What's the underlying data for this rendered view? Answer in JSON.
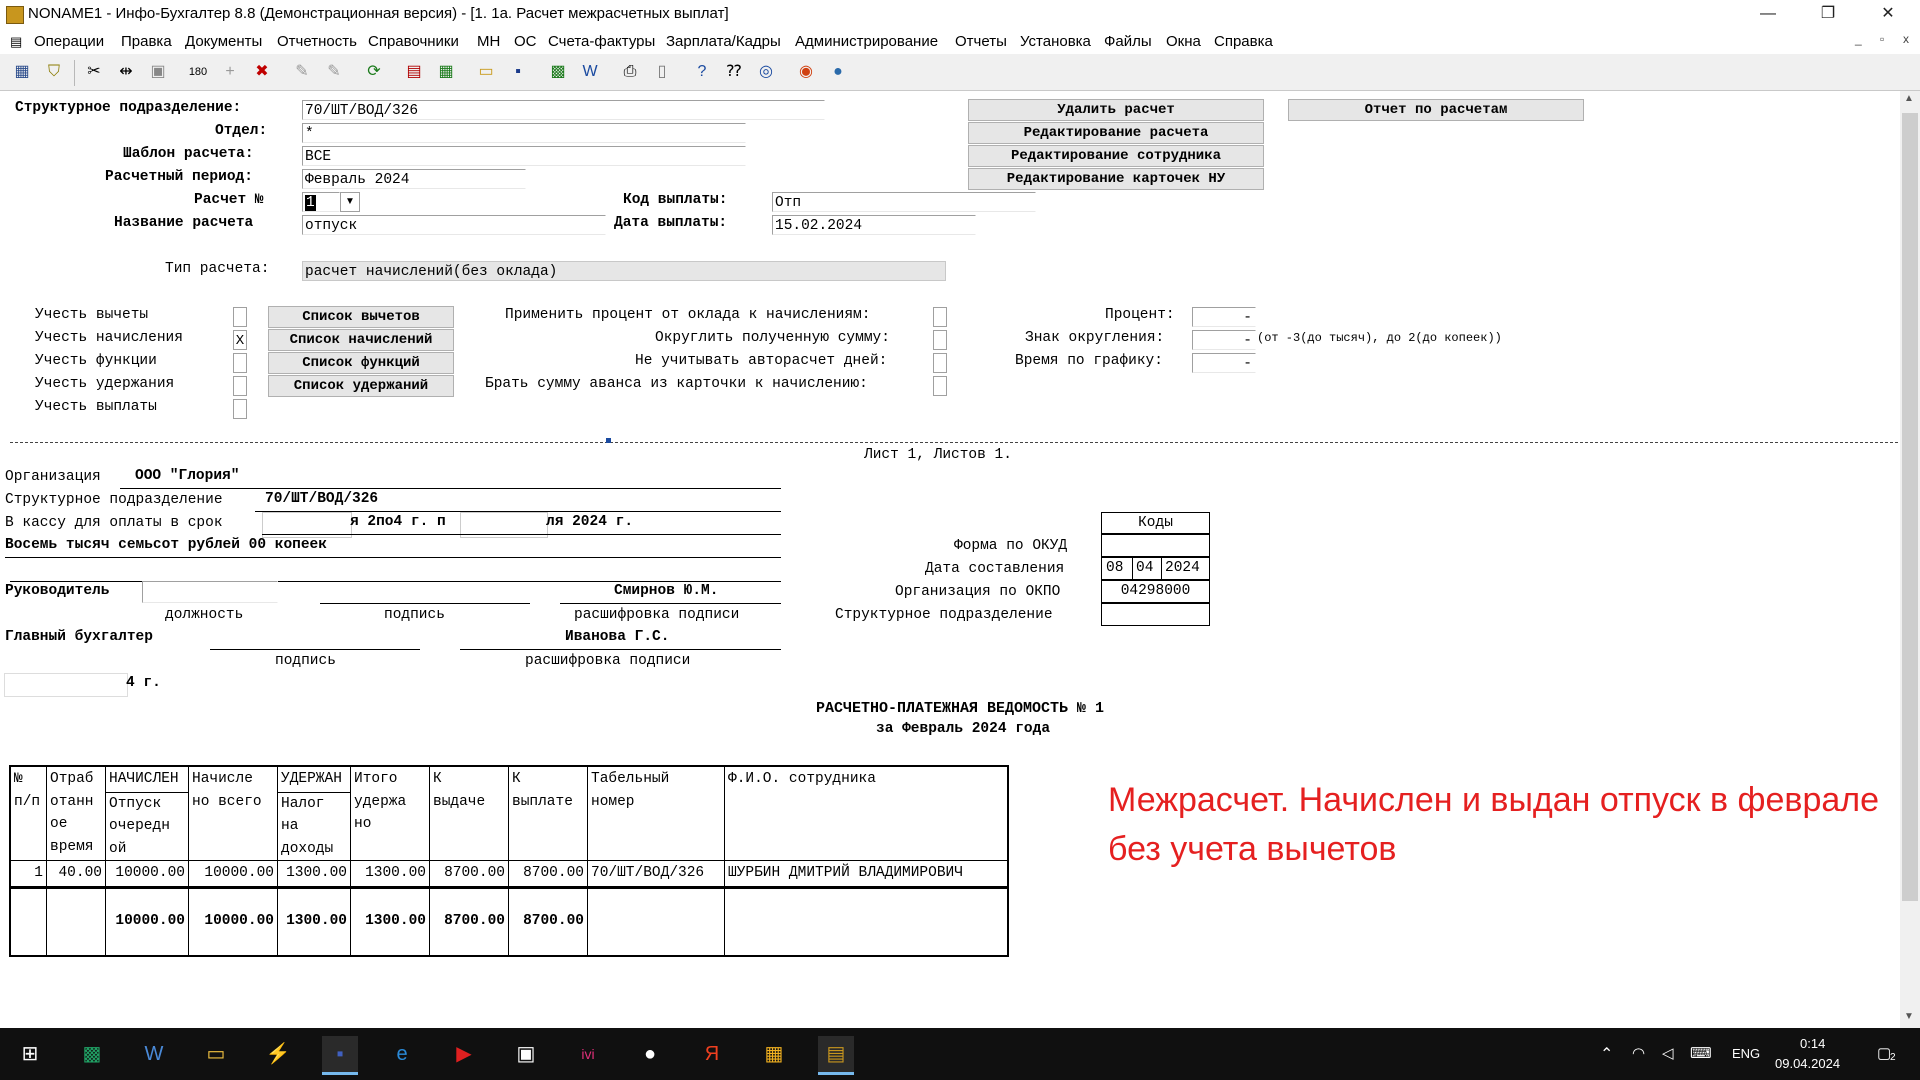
{
  "window": {
    "title": "NONAME1 - Инфо-Бухгалтер 8.8 (Демонстрационная версия) - [1. 1а. Расчет межрасчетных выплат]",
    "minimize": "—",
    "maximize": "❐",
    "close": "✕"
  },
  "menu": {
    "items": [
      "Операции",
      "Правка",
      "Документы",
      "Отчетность",
      "Справочники",
      "МН",
      "ОС",
      "Счета-фактуры",
      "Зарплата/Кадры",
      "Администрирование",
      "Отчеты",
      "Установка",
      "Файлы",
      "Окна",
      "Справка"
    ],
    "mdi_min": "_",
    "mdi_restore": "▫",
    "mdi_close": "x"
  },
  "form": {
    "structural_unit_label": "Структурное подразделение:",
    "structural_unit_value": "70/ШТ/ВОД/326",
    "department_label": "Отдел:",
    "department_value": "*",
    "template_label": "Шаблон расчета:",
    "template_value": "ВСЕ",
    "period_label": "Расчетный период:",
    "period_value": "Февраль 2024",
    "calc_no_label": "Расчет №",
    "calc_no_value": "1",
    "calc_name_label": "Название расчета",
    "calc_name_value": "отпуск",
    "pay_code_label": "Код выплаты:",
    "pay_code_value": "Отп",
    "pay_date_label": "Дата выплаты:",
    "pay_date_value": "15.02.2024",
    "calc_type_label": "Тип расчета:",
    "calc_type_value": "расчет начислений(без оклада)",
    "btn_delete": "Удалить расчет",
    "btn_edit_calc": "Редактирование расчета",
    "btn_edit_employee": "Редактирование сотрудника",
    "btn_edit_cards": "Редактирование карточек НУ",
    "btn_report": "Отчет по расчетам",
    "consider": [
      {
        "label": "Учесть вычеты",
        "checked": ""
      },
      {
        "label": "Учесть начисления",
        "checked": "X"
      },
      {
        "label": "Учесть функции",
        "checked": ""
      },
      {
        "label": "Учесть удержания",
        "checked": ""
      },
      {
        "label": "Учесть выплаты",
        "checked": ""
      }
    ],
    "list_buttons": [
      "Список вычетов",
      "Список начислений",
      "Список функций",
      "Список удержаний"
    ],
    "options": [
      {
        "label": "Применить процент от оклада к начислениям:",
        "checked": ""
      },
      {
        "label": "Округлить полученную сумму:",
        "checked": ""
      },
      {
        "label": "Не учитывать авторасчет дней:",
        "checked": ""
      },
      {
        "label": "Брать сумму аванса из карточки к начислению:",
        "checked": ""
      }
    ],
    "percent_label": "Процент:",
    "percent_value": "-",
    "round_sign_label": "Знак округления:",
    "round_sign_value": "-",
    "round_hint": "(от -3(до тысяч), до 2(до копеек))",
    "schedule_label": "Время по графику:",
    "schedule_value": "-"
  },
  "report": {
    "sheet": "Лист 1, Листов 1.",
    "org_label": "Организация",
    "org_value": "ООО \"Глория\"",
    "unit_label": "Структурное подразделение",
    "unit_value": "70/ШТ/ВОД/326",
    "cash_label": "В кассу для оплаты в срок",
    "cash_mid": "я 2по4 г. п",
    "cash_end": "ля 2024 г.",
    "amount_words": "Восемь тысяч семьсот рублей 00 копеек",
    "head_label": "Руководитель",
    "head_name": "Смирнов Ю.М.",
    "position_caption": "должность",
    "signature_caption": "подпись",
    "decode_caption": "расшифровка подписи",
    "chief_label": "Главный бухгалтер",
    "chief_name": "Иванова Г.С.",
    "date_tail": "4 г.",
    "codes_header": "Коды",
    "okud_label": "Форма по ОКУД",
    "date_label": "Дата составления",
    "date_day": "08",
    "date_month": "04",
    "date_year": "2024",
    "okpo_label": "Организация по ОКПО",
    "okpo_value": "04298000",
    "unit_code_label": "Структурное подразделение",
    "doc_title": "РАСЧЕТНО-ПЛАТЕЖНАЯ ВЕДОМОСТЬ № 1",
    "doc_subtitle": "за Февраль 2024 года",
    "table": {
      "headers": [
        [
          "№",
          "п/п"
        ],
        [
          "Отраб",
          "отанн",
          "ое",
          "время"
        ],
        [
          "НАЧИСЛЕН",
          "Отпуск",
          "очередн",
          "ой"
        ],
        [
          "Начисле",
          "но всего"
        ],
        [
          "УДЕРЖАН",
          "Налог",
          "на",
          "доходы"
        ],
        [
          "Итого",
          "удержа",
          "но"
        ],
        [
          "К",
          "выдаче"
        ],
        [
          "К",
          "выплате"
        ],
        [
          "Табельный",
          "номер"
        ],
        [
          "Ф.И.О. сотрудника"
        ]
      ],
      "rows": [
        [
          "1",
          "40.00",
          "10000.00",
          "10000.00",
          "1300.00",
          "1300.00",
          "8700.00",
          "8700.00",
          "70/ШТ/ВОД/326",
          "ШУРБИН ДМИТРИЙ ВЛАДИМИРОВИЧ"
        ]
      ],
      "totals": [
        "",
        "",
        "10000.00",
        "10000.00",
        "1300.00",
        "1300.00",
        "8700.00",
        "8700.00",
        "",
        ""
      ]
    }
  },
  "annotation": "Межрасчет. Начислен и выдан отпуск в феврале без учета вычетов",
  "taskbar": {
    "lang": "ENG",
    "time": "0:14",
    "date": "09.04.2024",
    "notifications": "2"
  }
}
